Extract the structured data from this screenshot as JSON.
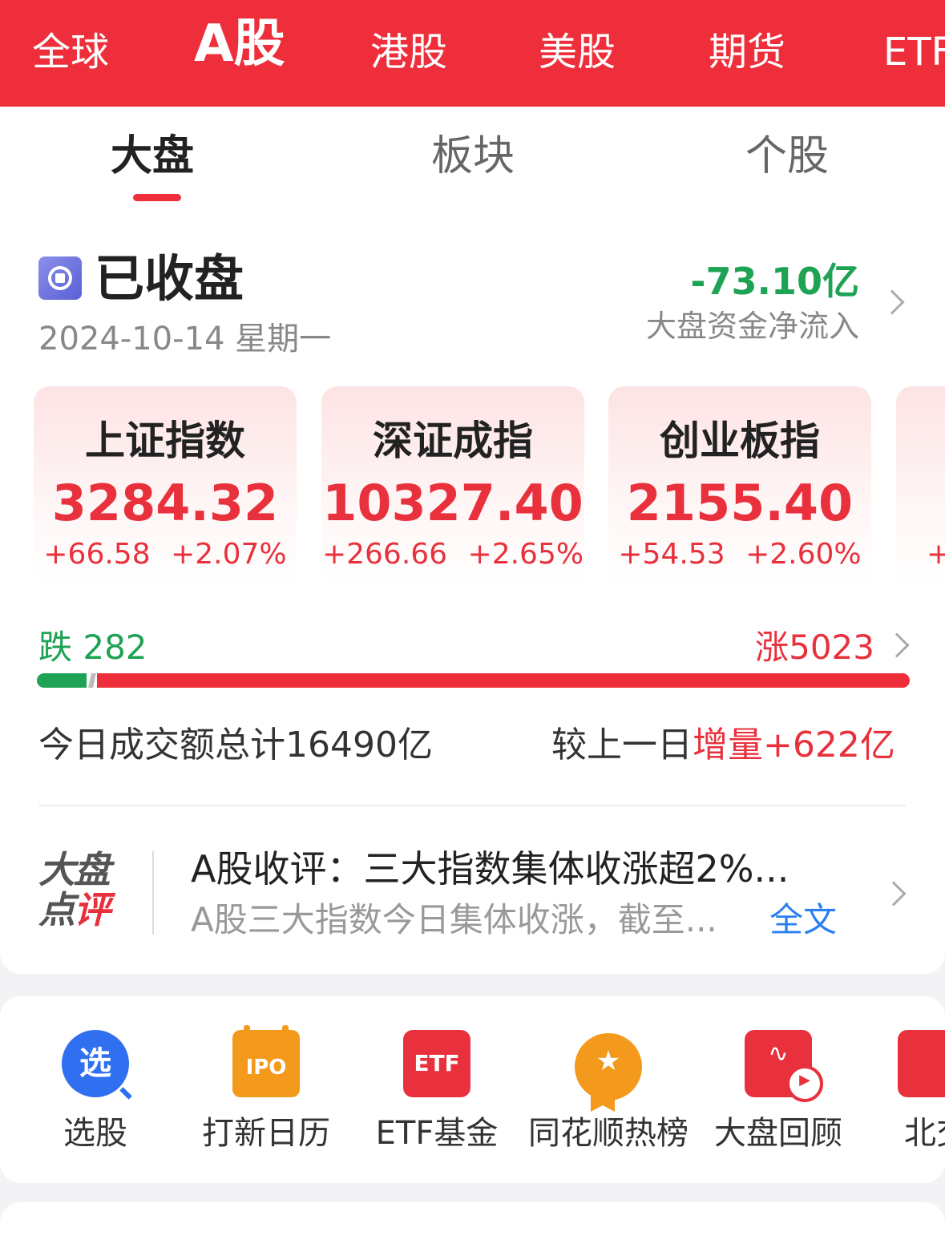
{
  "top_tabs": [
    "全球",
    "A股",
    "港股",
    "美股",
    "期货",
    "ETF"
  ],
  "sub_tabs": [
    "大盘",
    "板块",
    "个股"
  ],
  "market": {
    "status": "已收盘",
    "date": "2024-10-14 星期一",
    "net_flow_value": "-73.10亿",
    "net_flow_label": "大盘资金净流入"
  },
  "indices": [
    {
      "name": "上证指数",
      "value": "3284.32",
      "change": "+66.58",
      "change_pct": "+2.07%"
    },
    {
      "name": "深证成指",
      "value": "10327.40",
      "change": "+266.66",
      "change_pct": "+2.65%"
    },
    {
      "name": "创业板指",
      "value": "2155.40",
      "change": "+54.53",
      "change_pct": "+2.60%"
    },
    {
      "name": "",
      "value": "",
      "change": "+",
      "change_pct": ""
    }
  ],
  "breadth": {
    "fall_label": "跌 282",
    "rise_label": "涨5023",
    "fall_count": 282,
    "rise_count": 5023
  },
  "volume": {
    "total_label": "今日成交额总计16490亿",
    "compare_prefix": "较上一日",
    "compare_increase": "增量+622亿"
  },
  "review": {
    "logo_line1": "大盘",
    "logo_line2_a": "点",
    "logo_line2_b": "评",
    "title": "A股收评：三大指数集体收涨超2%...",
    "summary": "A股三大指数今日集体收涨，截至...",
    "full_text_link": "全文"
  },
  "tools": [
    {
      "icon": "选",
      "label": "选股"
    },
    {
      "icon": "IPO",
      "label": "打新日历"
    },
    {
      "icon": "ETF",
      "label": "ETF基金"
    },
    {
      "icon": "★",
      "label": "同花顺热榜"
    },
    {
      "icon": "∿",
      "label": "大盘回顾"
    },
    {
      "icon": "",
      "label": "北交"
    }
  ],
  "colors": {
    "brand_red": "#ee2f3b",
    "rise_red": "#e8313d",
    "fall_green": "#1ea354",
    "link_blue": "#2a7ff0"
  }
}
